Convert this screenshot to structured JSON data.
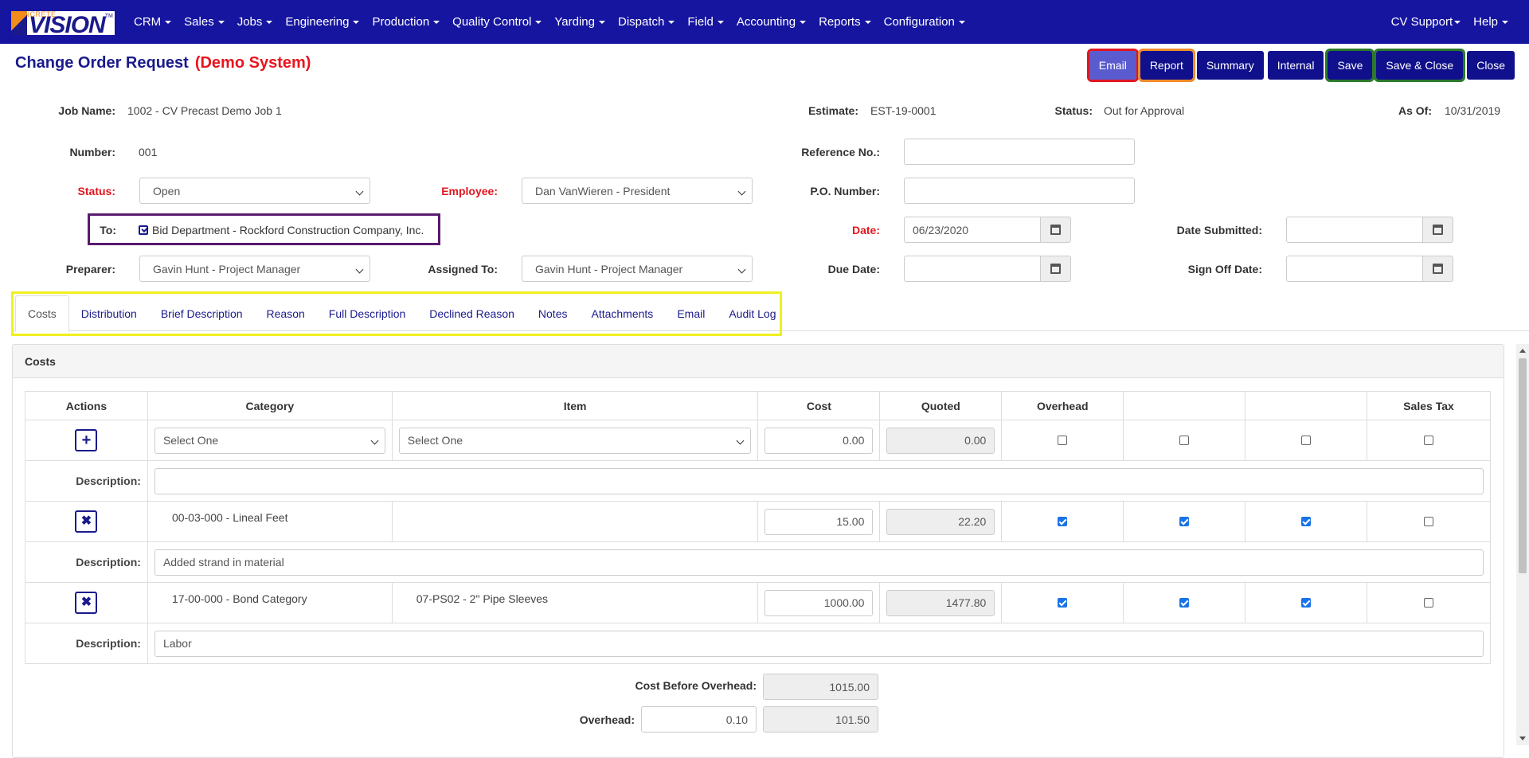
{
  "nav": {
    "logo_small": "CONCRETE",
    "logo": "VISION",
    "logo_tm": "TM",
    "menu": [
      "CRM",
      "Sales",
      "Jobs",
      "Engineering",
      "Production",
      "Quality Control",
      "Yarding",
      "Dispatch",
      "Field",
      "Accounting",
      "Reports",
      "Configuration"
    ],
    "right_menu": [
      "CV Support",
      "Help"
    ]
  },
  "header": {
    "title": "Change Order Request",
    "demo": "(Demo System)",
    "buttons": [
      "Email",
      "Report",
      "Summary",
      "Internal",
      "Save",
      "Save & Close",
      "Close"
    ]
  },
  "form": {
    "job_name_label": "Job Name:",
    "job_name": "1002 - CV Precast Demo Job 1",
    "estimate_label": "Estimate:",
    "estimate": "EST-19-0001",
    "status_top_label": "Status:",
    "status_top": "Out for Approval",
    "as_of_label": "As Of:",
    "as_of": "10/31/2019",
    "number_label": "Number:",
    "number": "001",
    "reference_label": "Reference No.:",
    "reference": "",
    "status_label": "Status:",
    "status": "Open",
    "employee_label": "Employee:",
    "employee": "Dan VanWieren - President",
    "po_label": "P.O. Number:",
    "po": "",
    "to_label": "To:",
    "to": "Bid Department - Rockford Construction Company, Inc.",
    "date_label": "Date:",
    "date": "06/23/2020",
    "date_submitted_label": "Date Submitted:",
    "date_submitted": "",
    "preparer_label": "Preparer:",
    "preparer": "Gavin Hunt - Project Manager",
    "assigned_label": "Assigned To:",
    "assigned": "Gavin Hunt - Project Manager",
    "due_label": "Due Date:",
    "due": "",
    "sign_off_label": "Sign Off Date:",
    "sign_off": ""
  },
  "tabs": [
    "Costs",
    "Distribution",
    "Brief Description",
    "Reason",
    "Full Description",
    "Declined Reason",
    "Notes",
    "Attachments",
    "Email",
    "Audit Log"
  ],
  "costs": {
    "panel_title": "Costs",
    "headers": [
      "Actions",
      "Category",
      "Item",
      "Cost",
      "Quoted",
      "Overhead",
      "",
      "",
      "Sales Tax"
    ],
    "new_row": {
      "category": "Select One",
      "item": "Select One",
      "cost": "0.00",
      "quoted": "0.00"
    },
    "description_label": "Description:",
    "new_description": "",
    "rows": [
      {
        "category": "00-03-000 - Lineal Feet",
        "item": "",
        "cost": "15.00",
        "quoted": "22.20",
        "description": "Added strand in material",
        "checks": [
          true,
          true,
          true,
          false
        ]
      },
      {
        "category": "17-00-000 - Bond Category",
        "item": "07-PS02 - 2\" Pipe Sleeves",
        "cost": "1000.00",
        "quoted": "1477.80",
        "description": "Labor",
        "checks": [
          true,
          true,
          true,
          false
        ]
      }
    ],
    "footer": {
      "before_overhead_label": "Cost Before Overhead:",
      "before_overhead": "1015.00",
      "overhead_label": "Overhead:",
      "overhead_rate": "0.10",
      "overhead_amount": "101.50"
    }
  },
  "colors": {
    "nav": "#1515a0",
    "accent": "#1a1a8c",
    "required": "#e0161e"
  }
}
